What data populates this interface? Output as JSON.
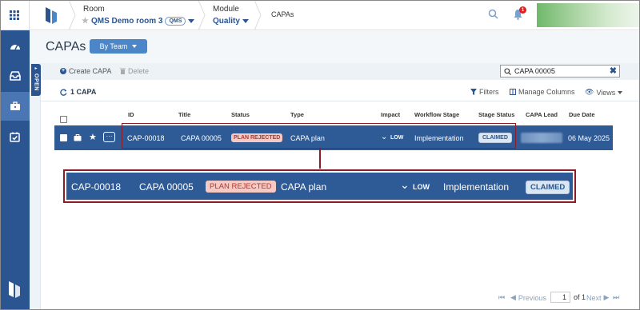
{
  "header": {
    "room_label": "Room",
    "room_value": "QMS Demo room 3",
    "room_badge": "QMS",
    "module_label": "Module",
    "module_value": "Quality",
    "page_crumb": "CAPAs",
    "notification_count": "1"
  },
  "titlebar": {
    "title": "CAPAs",
    "team_button": "By Team"
  },
  "open_tab": "OPEN",
  "actions": {
    "create": "Create CAPA",
    "delete": "Delete",
    "search_value": "CAPA 00005"
  },
  "toolbar": {
    "count": "1 CAPA",
    "filters": "Filters",
    "manage_columns": "Manage Columns",
    "views": "Views"
  },
  "table": {
    "columns": [
      "ID",
      "Title",
      "Status",
      "Type",
      "Impact",
      "Workflow Stage",
      "Stage Status",
      "CAPA Lead",
      "Due Date"
    ],
    "row": {
      "id": "CAP-00018",
      "title": "CAPA 00005",
      "status": "PLAN REJECTED",
      "type": "CAPA plan",
      "impact": "LOW",
      "workflow_stage": "Implementation",
      "stage_status": "CLAIMED",
      "due_date": "06 May 2025"
    }
  },
  "pagination": {
    "previous": "Previous",
    "page": "1",
    "of": "of 1",
    "next": "Next"
  },
  "colors": {
    "rail": "#2b5590",
    "row_selected": "#2e5a96",
    "callout": "#8b1d2a",
    "accent_button": "#4a86c8"
  }
}
